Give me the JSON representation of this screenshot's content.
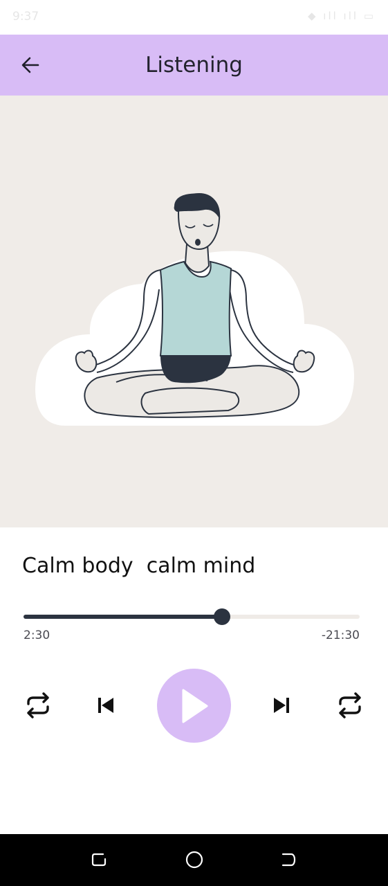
{
  "status_bar": {
    "time": "9:37",
    "icons_text": "◆ ıll ıll ▭"
  },
  "app_bar": {
    "title": "Listening",
    "back_icon": "arrow-left-icon"
  },
  "hero": {
    "illustration": "meditating-person-illustration",
    "background_color": "#f0ece8"
  },
  "track": {
    "title": "Calm body  calm mind",
    "elapsed": "2:30",
    "remaining": "-21:30",
    "progress_fraction": 0.59
  },
  "controls": {
    "repeat_left_icon": "repeat-icon",
    "previous_icon": "skip-previous-icon",
    "play_icon": "play-icon",
    "next_icon": "skip-next-icon",
    "repeat_right_icon": "repeat-icon"
  },
  "nav_bar": {
    "recents_icon": "recents-icon",
    "home_icon": "home-circle-icon",
    "back_icon": "system-back-icon"
  },
  "colors": {
    "accent": "#d8bcf6",
    "progress": "#2b3340",
    "hero_bg": "#f0ece8"
  }
}
